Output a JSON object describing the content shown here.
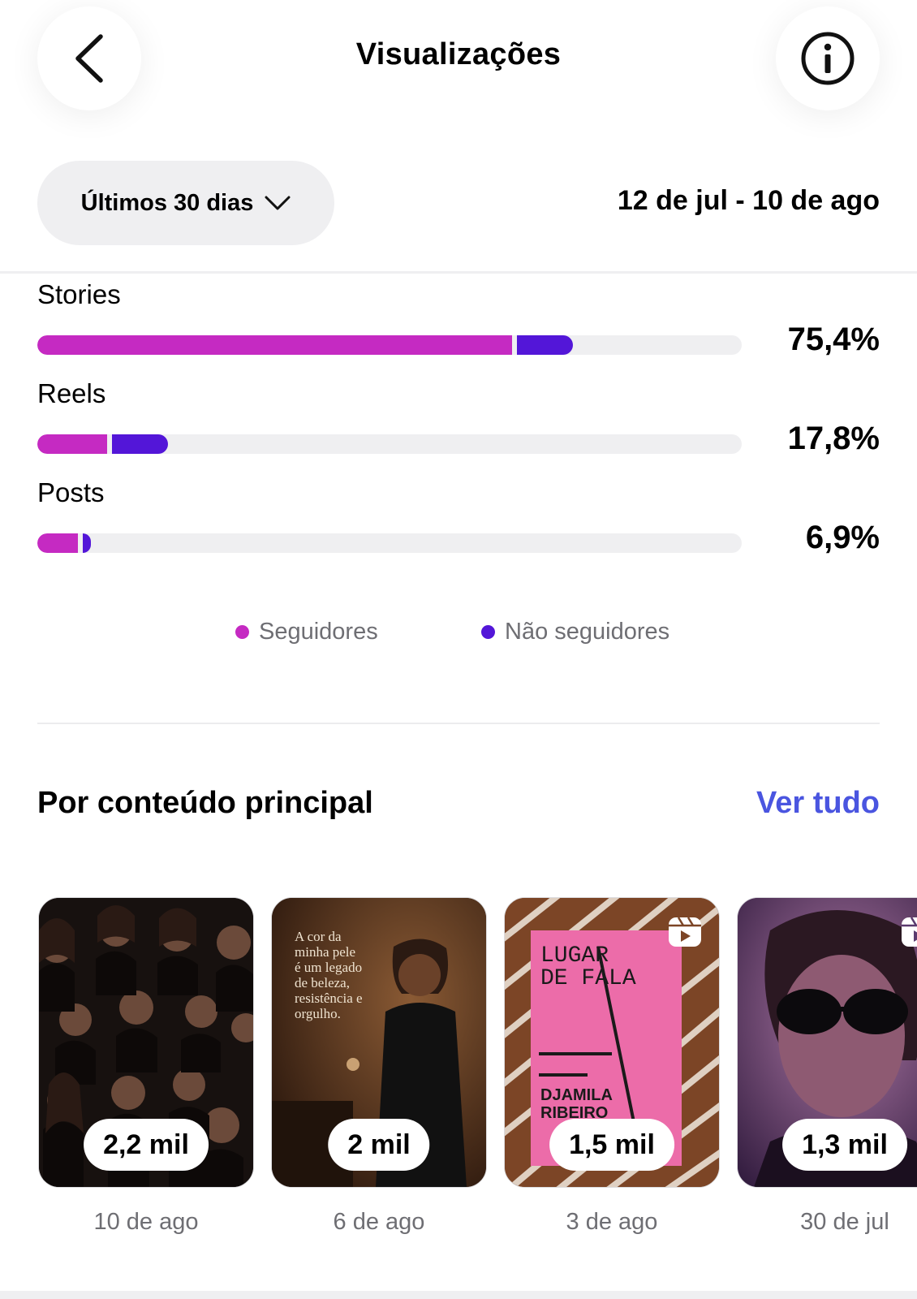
{
  "header": {
    "title": "Visualizações"
  },
  "filter": {
    "range_label": "Últimos 30 dias",
    "date_range": "12 de jul - 10 de ago"
  },
  "colors": {
    "followers": "#c52ac2",
    "non_followers": "#5316d8",
    "link": "#4a55e0"
  },
  "chart_data": {
    "type": "bar",
    "orientation": "horizontal",
    "stacked": true,
    "categories": [
      "Stories",
      "Reels",
      "Posts"
    ],
    "totals_label": [
      "75,4%",
      "17,8%",
      "6,9%"
    ],
    "series": [
      {
        "name": "Seguidores",
        "values": [
          67.4,
          9.9,
          5.8
        ]
      },
      {
        "name": "Não seguidores",
        "values": [
          8.0,
          7.9,
          1.1
        ]
      }
    ],
    "xlim": [
      0,
      100
    ]
  },
  "legend": {
    "followers": "Seguidores",
    "non_followers": "Não seguidores"
  },
  "top_content": {
    "title": "Por conteúdo principal",
    "see_all": "Ver tudo",
    "items": [
      {
        "views": "2,2 mil",
        "date": "10 de ago",
        "is_reel": false
      },
      {
        "views": "2 mil",
        "date": "6 de ago",
        "is_reel": false,
        "caption": [
          "A cor da",
          "minha pele",
          "é um legado",
          "de beleza,",
          "resistência e",
          "orgulho."
        ]
      },
      {
        "views": "1,5 mil",
        "date": "3 de ago",
        "is_reel": true,
        "book": {
          "title": "LUGAR DE FALA",
          "author": "DJAMILA RIBEIRO"
        }
      },
      {
        "views": "1,3 mil",
        "date": "30 de jul",
        "is_reel": true
      }
    ]
  }
}
